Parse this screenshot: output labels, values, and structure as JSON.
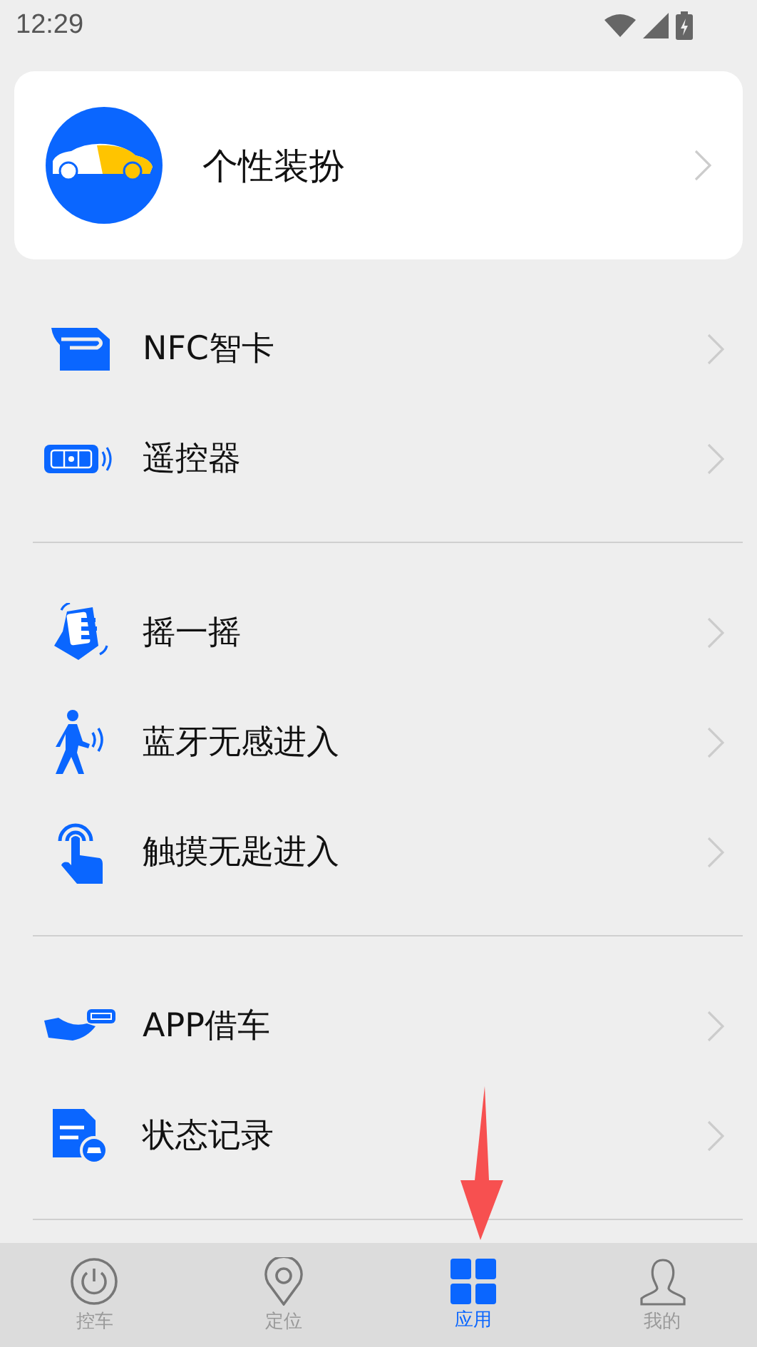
{
  "status_bar": {
    "time": "12:29"
  },
  "profile_card": {
    "label": "个性装扮"
  },
  "sections": [
    {
      "items": [
        {
          "kind": "card",
          "label": "NFC智卡"
        },
        {
          "kind": "remote",
          "label": "遥控器"
        }
      ]
    },
    {
      "items": [
        {
          "kind": "shake",
          "label": "摇一摇"
        },
        {
          "kind": "walk",
          "label": "蓝牙无感进入"
        },
        {
          "kind": "touch",
          "label": "触摸无匙进入"
        }
      ]
    },
    {
      "items": [
        {
          "kind": "lend",
          "label": "APP借车"
        },
        {
          "kind": "record",
          "label": "状态记录"
        }
      ]
    }
  ],
  "tab_bar": [
    {
      "kind": "power",
      "label": "控车",
      "selected": false
    },
    {
      "kind": "pin",
      "label": "定位",
      "selected": false
    },
    {
      "kind": "grid",
      "label": "应用",
      "selected": true
    },
    {
      "kind": "person",
      "label": "我的",
      "selected": false
    }
  ]
}
